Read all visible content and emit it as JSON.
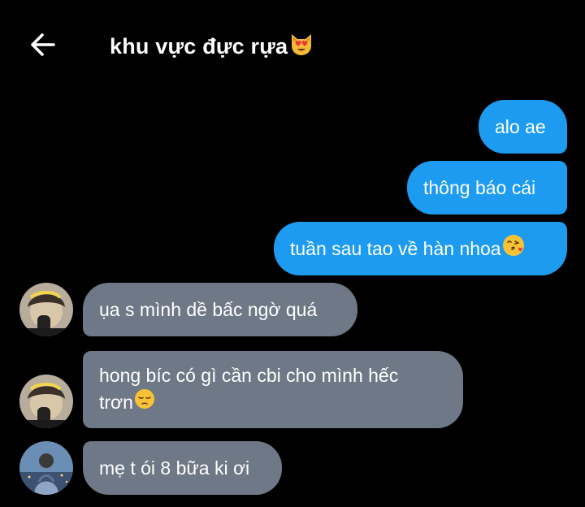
{
  "header": {
    "back_icon": "arrow-left-icon",
    "title": "khu vực đực rựa",
    "title_emoji": "heart-eyes-cat-emoji"
  },
  "messages": [
    {
      "direction": "outgoing",
      "text": "alo ae"
    },
    {
      "direction": "outgoing",
      "text": "thông báo cái"
    },
    {
      "direction": "outgoing",
      "text": "tuần sau tao về hàn nhoa",
      "emoji": "kissing-heart-face-emoji"
    },
    {
      "direction": "incoming",
      "text": "ụa s mình dề bấc ngờ quá",
      "avatar": "avatar-user-1"
    },
    {
      "direction": "incoming",
      "text_line1": "hong bíc có gì cần cbi cho mình hếc",
      "text_line2": "trơn",
      "emoji": "pensive-face-emoji",
      "avatar": "avatar-user-1"
    },
    {
      "direction": "incoming",
      "text": "mẹ t ói 8 bữa ki ơi",
      "avatar": "avatar-user-2"
    }
  ],
  "colors": {
    "background": "#000000",
    "outgoing_bubble": "#1c9bf0",
    "incoming_bubble": "#6e7886",
    "text": "#ffffff"
  }
}
